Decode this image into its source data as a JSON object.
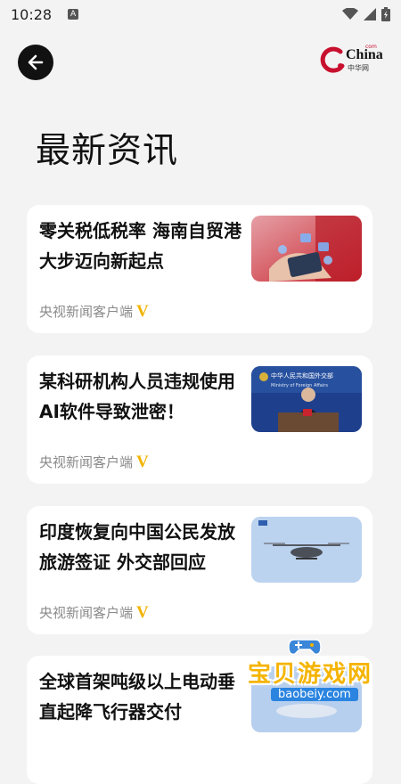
{
  "status_bar": {
    "time": "10:28",
    "notification_glyph": "A",
    "icons": [
      "wifi-icon",
      "signal-icon",
      "battery-icon"
    ]
  },
  "header": {
    "back_icon": "arrow-left-icon",
    "logo": {
      "main": "China",
      "sub": "中华网",
      "com": "com"
    }
  },
  "page_title": "最新资讯",
  "news": [
    {
      "title": "零关税低税率 海南自贸港大步迈向新起点",
      "source": "央视新闻客户端",
      "badge": "V",
      "thumbnail": "hands-phone-image"
    },
    {
      "title": "某科研机构人员违规使用AI软件导致泄密！",
      "source": "央视新闻客户端",
      "badge": "V",
      "thumbnail": "press-conference-image",
      "thumb_text_1": "中华人民共和国外交部",
      "thumb_text_2": "Ministry of Foreign Affairs"
    },
    {
      "title": "印度恢复向中国公民发放旅游签证 外交部回应",
      "source": "央视新闻客户端",
      "badge": "V",
      "thumbnail": "evtol-aircraft-image"
    },
    {
      "title": "全球首架吨级以上电动垂直起降飞行器交付",
      "source": "",
      "badge": "",
      "thumbnail": "aircraft-image"
    }
  ],
  "watermark": {
    "text": "宝贝游戏网",
    "url": "baobeiy.com"
  },
  "colors": {
    "accent": "#c8102e",
    "badge": "#f2b300",
    "background": "#f3f3f3"
  }
}
